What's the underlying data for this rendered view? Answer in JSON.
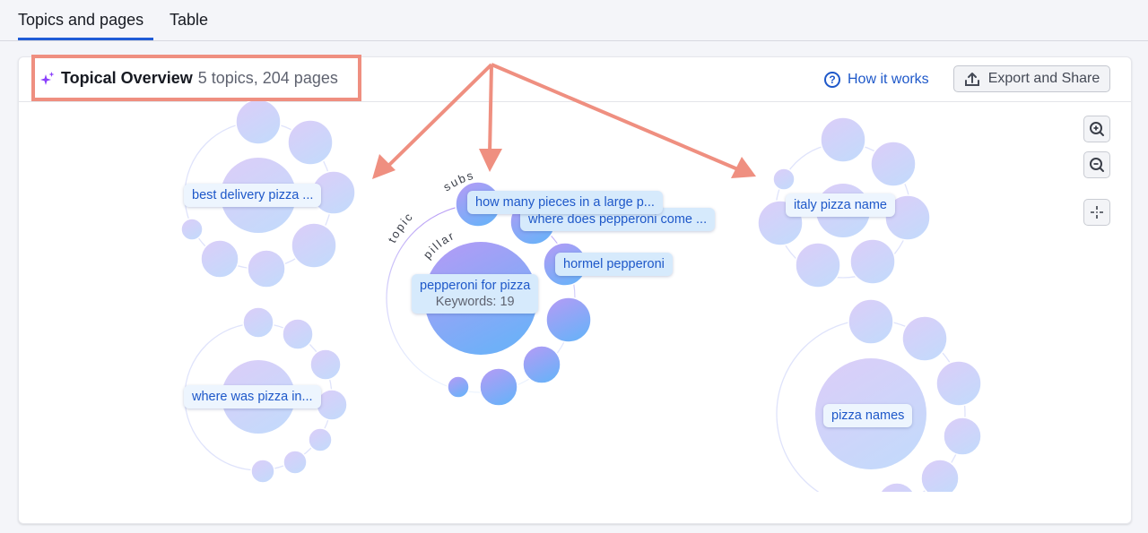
{
  "tabs": [
    {
      "label": "Topics and pages",
      "active": true
    },
    {
      "label": "Table",
      "active": false
    }
  ],
  "header": {
    "title": "Topical Overview",
    "subtitle": "5 topics, 204 pages",
    "how_it_works_label": "How it works",
    "export_label": "Export and Share",
    "icons": {
      "title": "sparkle-icon",
      "how_it_works": "question-circle-icon",
      "export": "upload-icon"
    }
  },
  "controls": [
    {
      "name": "zoom-in",
      "icon": "zoom-in-icon"
    },
    {
      "name": "zoom-out",
      "icon": "zoom-out-icon"
    },
    {
      "name": "center",
      "icon": "crosshair-icon"
    }
  ],
  "graph": {
    "ring_labels": {
      "subs": "subs",
      "topic": "topic",
      "pillar": "pillar"
    },
    "topics": [
      {
        "id": "best-delivery",
        "label": "best delivery pizza ...",
        "subtopic_count": 8,
        "selected": false
      },
      {
        "id": "where-was-pizza",
        "label": "where was pizza in...",
        "subtopic_count": 9,
        "selected": false
      },
      {
        "id": "pepperoni",
        "label": "pepperoni for pizza",
        "keywords_label": "Keywords: 19",
        "selected": true,
        "subtopics": [
          {
            "label": "how many pieces in a large p..."
          },
          {
            "label": "where does pepperoni come ..."
          },
          {
            "label": "hormel pepperoni"
          }
        ],
        "subtopic_count": 8
      },
      {
        "id": "italy-pizza",
        "label": "italy pizza name",
        "subtopic_count": 7,
        "selected": false
      },
      {
        "id": "pizza-names",
        "label": "pizza names",
        "subtopic_count": 7,
        "selected": false
      }
    ]
  },
  "colors": {
    "accent": "#1f5bd6",
    "link": "#1e58c9",
    "annotation": "#ef8f80",
    "bubble_light_top": "#dccdf8",
    "bubble_light_bottom": "#c5d9fb",
    "bubble_active_top": "#b79af5",
    "bubble_active_bottom": "#6fb0f8"
  }
}
